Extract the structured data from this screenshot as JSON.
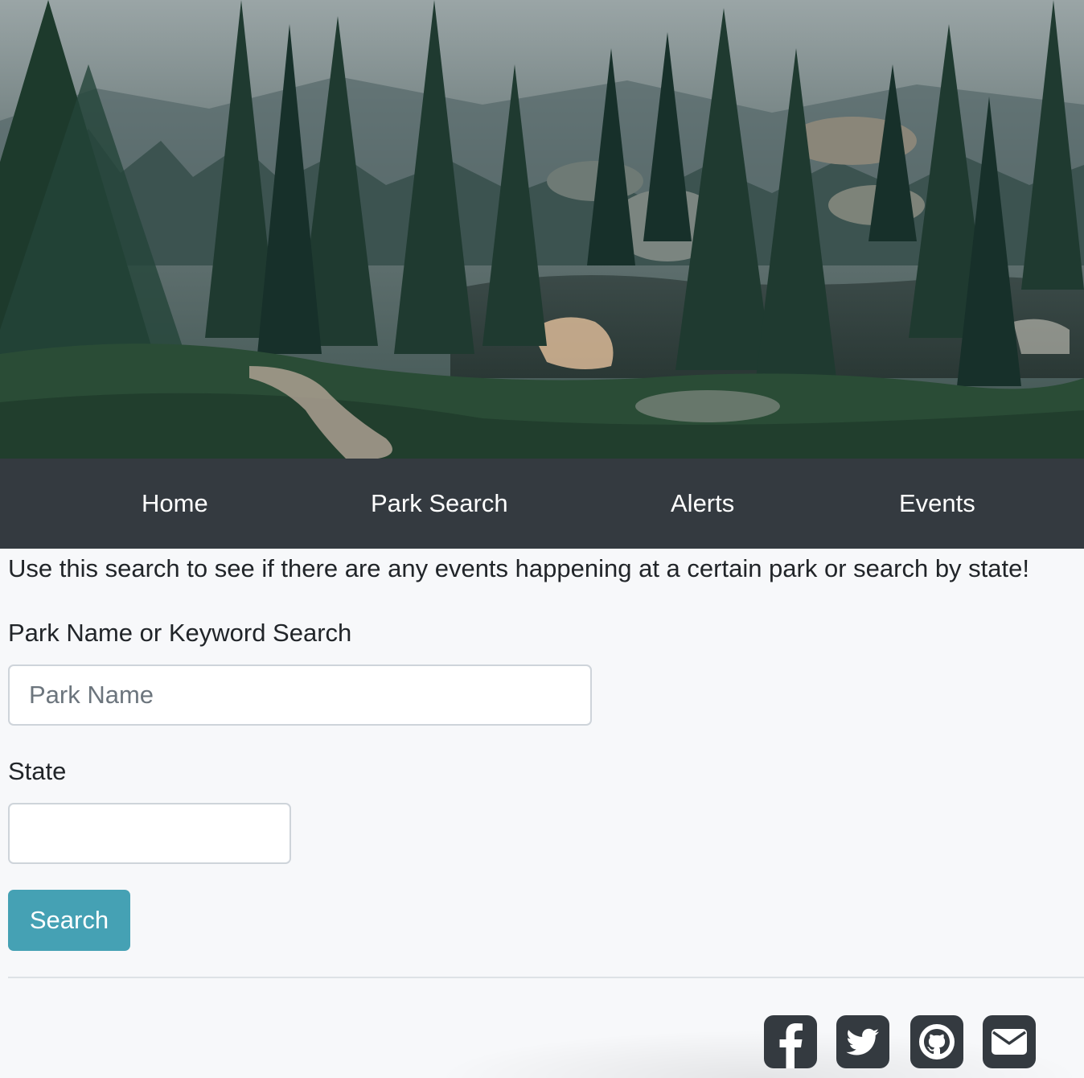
{
  "hero": {
    "image": "forest-lake-landscape"
  },
  "nav": {
    "items": [
      {
        "label": "Home"
      },
      {
        "label": "Park Search"
      },
      {
        "label": "Alerts"
      },
      {
        "label": "Events"
      }
    ],
    "background": "#343a40"
  },
  "main": {
    "intro": "Use this search to see if there are any events happening at a certain park or search by state!",
    "park_field": {
      "label": "Park Name or Keyword Search",
      "placeholder": "Park Name",
      "value": ""
    },
    "state_field": {
      "label": "State",
      "value": ""
    },
    "search_button": "Search",
    "button_color": "#45a1b4"
  },
  "footer": {
    "icons": [
      "facebook-icon",
      "twitter-icon",
      "github-icon",
      "envelope-icon"
    ]
  }
}
